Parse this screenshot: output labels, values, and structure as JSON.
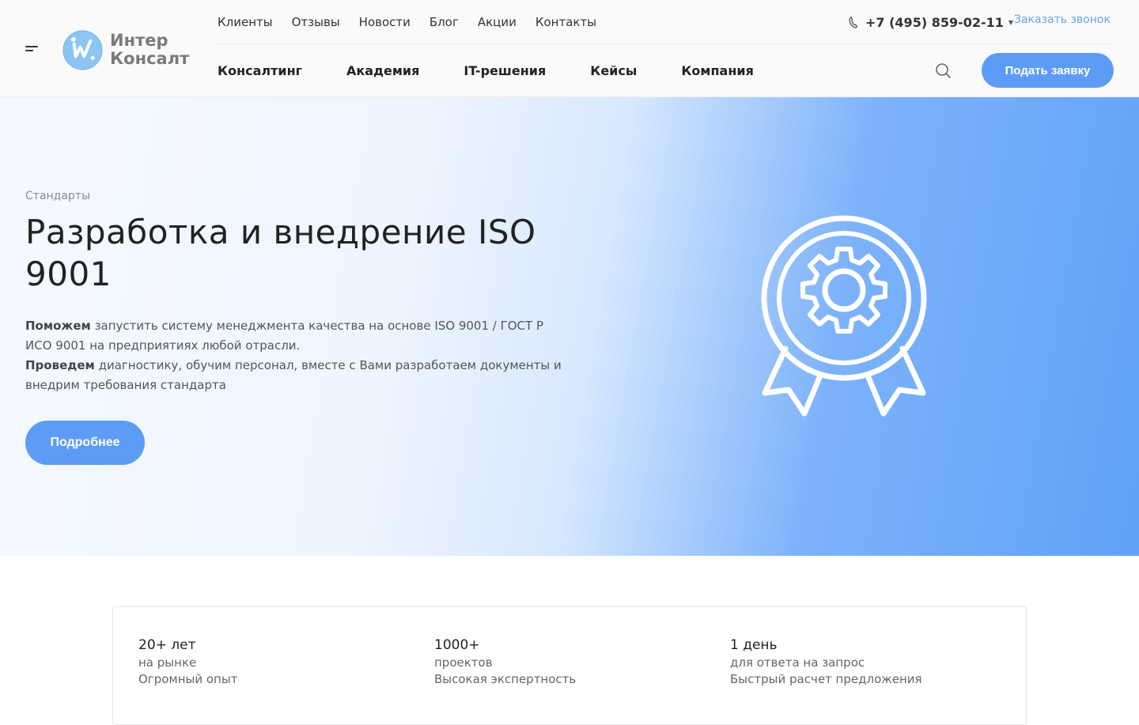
{
  "header": {
    "logo": {
      "line1": "Интер",
      "line2": "Консалт"
    },
    "top_nav": [
      "Клиенты",
      "Отзывы",
      "Новости",
      "Блог",
      "Акции",
      "Контакты"
    ],
    "phone": "+7 (495) 859-02-11",
    "callback": "Заказать звонок",
    "main_nav": [
      "Консалтинг",
      "Академия",
      "IT-решения",
      "Кейсы",
      "Компания"
    ],
    "cta": "Подать заявку"
  },
  "hero": {
    "breadcrumb": "Стандарты",
    "title": "Разработка и внедрение ISO 9001",
    "para1_bold": "Поможем",
    "para1_text": " запустить систему менеджмента качества на основе ISO 9001 / ГОСТ Р ИСО 9001 на предприятиях любой отрасли.",
    "para2_bold": "Проведем",
    "para2_text": " диагностику, обучим персонал, вместе с Вами разработаем документы и внедрим требования стандарта",
    "cta": "Подробнее"
  },
  "stats": [
    {
      "value": "20+ лет",
      "unit": "на рынке",
      "desc": "Огромный опыт"
    },
    {
      "value": "1000+",
      "unit": "проектов",
      "desc": "Высокая экспертность"
    },
    {
      "value": "1 день",
      "unit": "для ответа на запрос",
      "desc": "Быстрый расчет предложения"
    }
  ],
  "colors": {
    "accent": "#5c9cf6",
    "link": "#6aa2ef"
  },
  "icons": [
    "burger-menu-icon",
    "logo-mark-icon",
    "phone-icon",
    "search-icon",
    "award-gear-icon"
  ]
}
